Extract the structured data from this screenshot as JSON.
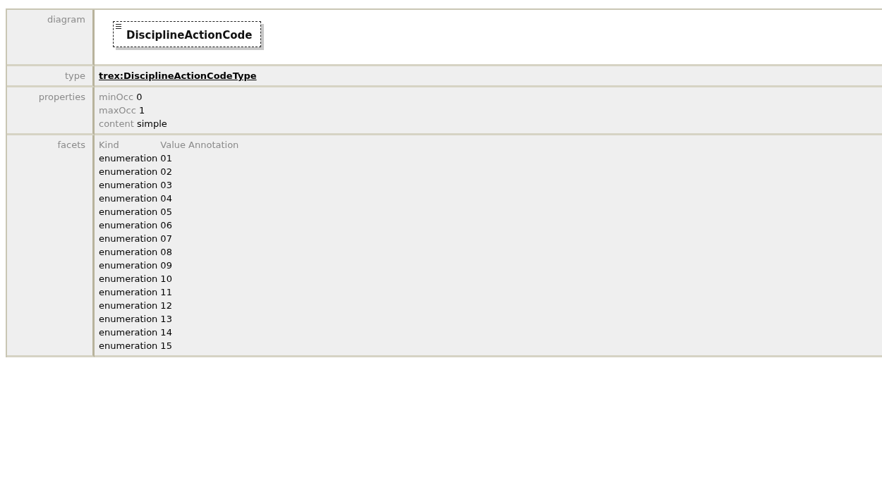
{
  "diagram": {
    "label": "diagram",
    "element": "DisciplineActionCode"
  },
  "type": {
    "label": "type",
    "value": "trex:DisciplineActionCodeType"
  },
  "properties": {
    "label": "properties",
    "items": [
      {
        "name": "minOcc",
        "value": "0"
      },
      {
        "name": "maxOcc",
        "value": "1"
      },
      {
        "name": "content",
        "value": "simple"
      }
    ]
  },
  "facets": {
    "label": "facets",
    "columns": [
      "Kind",
      "Value",
      "Annotation"
    ],
    "rows": [
      {
        "kind": "enumeration",
        "value": "01"
      },
      {
        "kind": "enumeration",
        "value": "02"
      },
      {
        "kind": "enumeration",
        "value": "03"
      },
      {
        "kind": "enumeration",
        "value": "04"
      },
      {
        "kind": "enumeration",
        "value": "05"
      },
      {
        "kind": "enumeration",
        "value": "06"
      },
      {
        "kind": "enumeration",
        "value": "07"
      },
      {
        "kind": "enumeration",
        "value": "08"
      },
      {
        "kind": "enumeration",
        "value": "09"
      },
      {
        "kind": "enumeration",
        "value": "10"
      },
      {
        "kind": "enumeration",
        "value": "11"
      },
      {
        "kind": "enumeration",
        "value": "12"
      },
      {
        "kind": "enumeration",
        "value": "13"
      },
      {
        "kind": "enumeration",
        "value": "14"
      },
      {
        "kind": "enumeration",
        "value": "15"
      }
    ]
  }
}
